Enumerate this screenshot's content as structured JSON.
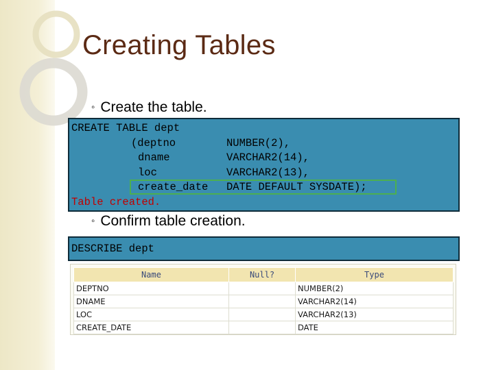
{
  "slide": {
    "title": "Creating Tables",
    "bullet1": "Create the table.",
    "bullet2": "Confirm table creation."
  },
  "create_code": {
    "line1": "CREATE TABLE dept",
    "rows": [
      {
        "col": "(deptno",
        "type": "NUMBER(2),"
      },
      {
        "col": "dname",
        "type": "VARCHAR2(14),"
      },
      {
        "col": "loc",
        "type": "VARCHAR2(13),"
      },
      {
        "col": "create_date",
        "type": "DATE DEFAULT SYSDATE);"
      }
    ],
    "result": "Table created."
  },
  "describe_code": {
    "line1": "DESCRIBE dept"
  },
  "describe_table": {
    "headers": [
      "Name",
      "Null?",
      "Type"
    ],
    "rows": [
      [
        "DEPTNO",
        "",
        "NUMBER(2)"
      ],
      [
        "DNAME",
        "",
        "VARCHAR2(14)"
      ],
      [
        "LOC",
        "",
        "VARCHAR2(13)"
      ],
      [
        "CREATE_DATE",
        "",
        "DATE"
      ]
    ]
  },
  "colors": {
    "title": "#5b2a14",
    "code_bg": "#3a8db0",
    "result_text": "#c00000",
    "highlight_border": "#4caf50",
    "table_header_bg": "#f2e5b0"
  }
}
